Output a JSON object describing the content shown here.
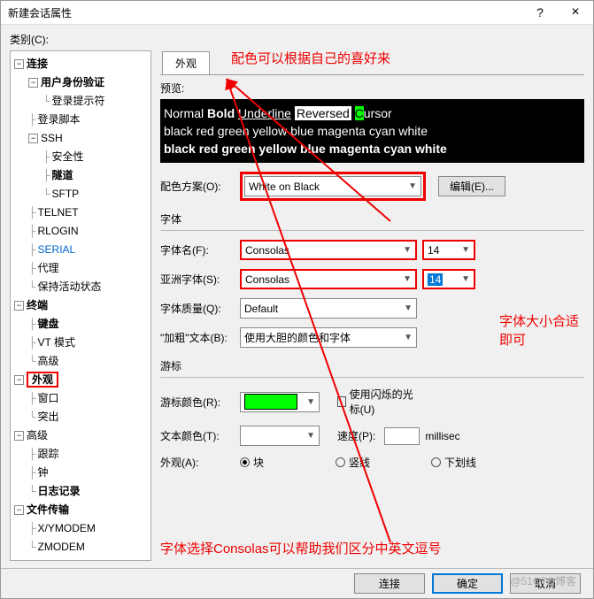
{
  "window": {
    "title": "新建会话属性",
    "help": "?",
    "close": "×"
  },
  "category_label": "类别(C):",
  "tree": {
    "connection": "连接",
    "userauth": "用户身份验证",
    "loginprompt": "登录提示符",
    "loginscript": "登录脚本",
    "ssh": "SSH",
    "security": "安全性",
    "tunnel": "隧道",
    "sftp": "SFTP",
    "telnet": "TELNET",
    "rlogin": "RLOGIN",
    "serial": "SERIAL",
    "proxy": "代理",
    "keepalive": "保持活动状态",
    "terminal": "终端",
    "keyboard": "键盘",
    "vtmode": "VT 模式",
    "advanced1": "高级",
    "appearance": "外观",
    "window": "窗口",
    "highlight": "突出",
    "advanced2": "高级",
    "trace": "跟踪",
    "bell": "钟",
    "logging": "日志记录",
    "filetransfer": "文件传输",
    "xymodem": "X/YMODEM",
    "zmodem": "ZMODEM"
  },
  "tab": {
    "appearance": "外观"
  },
  "preview_label": "预览:",
  "preview": {
    "normal": "Normal",
    "bold": "Bold",
    "underline": "Underline",
    "reversed": "Reversed",
    "cursor_c": "C",
    "cursor_rest": "ursor",
    "colors_line": "black red green yellow blue magenta cyan white",
    "colors_line_bold": "black red green yellow blue magenta cyan white"
  },
  "scheme": {
    "label": "配色方案(O):",
    "value": "White on Black",
    "edit": "编辑(E)..."
  },
  "font_section": "字体",
  "font": {
    "name_label": "字体名(F):",
    "name_value": "Consolas",
    "size_value": "14",
    "asian_label": "亚洲字体(S):",
    "asian_value": "Consolas",
    "asian_size_value": "14",
    "quality_label": "字体质量(Q):",
    "quality_value": "Default",
    "bold_label": "\"加粗\"文本(B):",
    "bold_value": "使用大胆的颜色和字体"
  },
  "cursor_section": "游标",
  "cursor": {
    "color_label": "游标颜色(R):",
    "use_blink": "使用闪烁的光标(U)",
    "text_color_label": "文本颜色(T):",
    "speed_label": "速度(P):",
    "speed_unit": "millisec",
    "shape_label": "外观(A):",
    "shape_block": "块",
    "shape_vert": "竖线",
    "shape_under": "下划线"
  },
  "annotations": {
    "top": "配色可以根据自己的喜好来",
    "right": "字体大小合适即可",
    "bottom": "字体选择Consolas可以帮助我们区分中英文逗号"
  },
  "buttons": {
    "connect": "连接",
    "ok": "确定",
    "cancel": "取消"
  },
  "watermark": "@51CTO博客"
}
